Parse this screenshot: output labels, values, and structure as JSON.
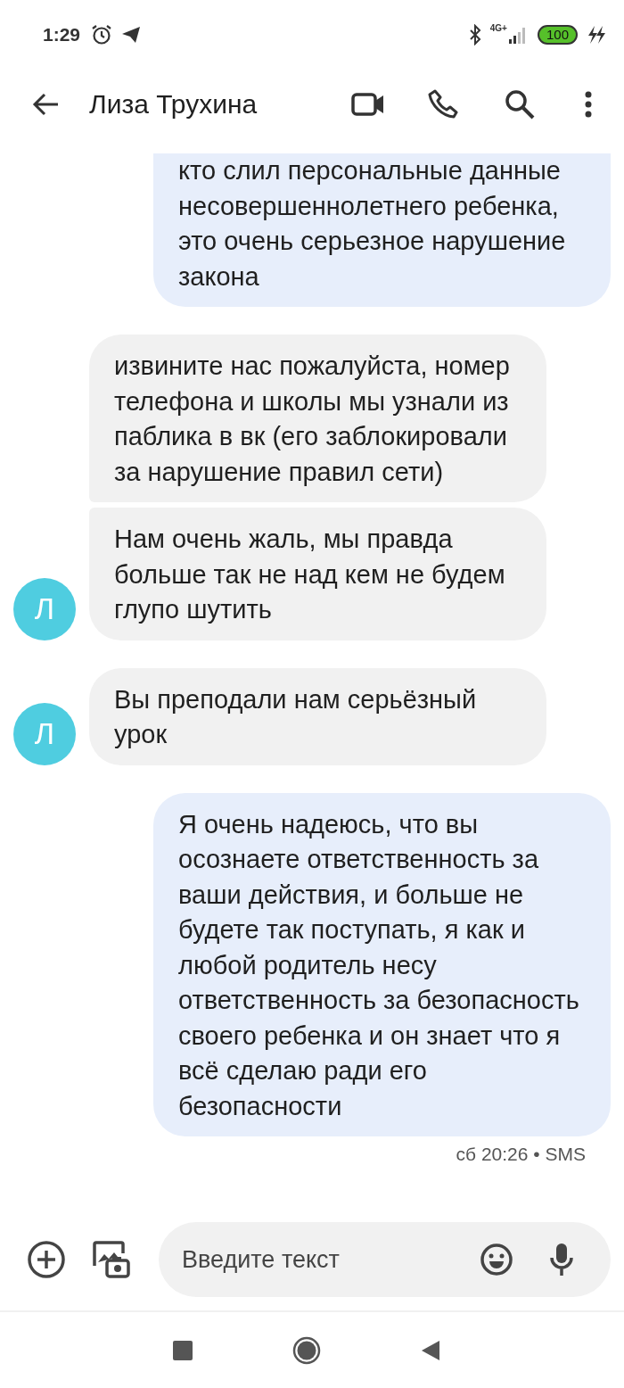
{
  "status_bar": {
    "time": "1:29",
    "network": "4G+",
    "battery": "100"
  },
  "header": {
    "contact": "Лиза Трухина"
  },
  "messages": [
    {
      "kind": "outgoing",
      "text": "кто слил персональные данные несовершеннолетнего ребенка, это очень серьезное нарушение закона"
    },
    {
      "kind": "incoming",
      "text": "извините нас пожалуйста, номер телефона и школы мы узнали из паблика в вк (его заблокировали за нарушение правил сети)"
    },
    {
      "kind": "incoming",
      "text": "Нам очень жаль, мы правда больше так не над кем не будем глупо шутить",
      "avatar": "Л"
    },
    {
      "kind": "incoming",
      "text": "Вы преподали нам серьёзный урок",
      "avatar": "Л"
    },
    {
      "kind": "outgoing",
      "text": "Я очень надеюсь, что вы осознаете ответственность за ваши действия, и больше не будете так поступать, я как и любой родитель несу ответственность за безопасность своего ребенка и он знает что я всё сделаю ради его безопасности",
      "footer": "сб 20:26 • SMS"
    }
  ],
  "compose": {
    "placeholder": "Введите текст"
  }
}
